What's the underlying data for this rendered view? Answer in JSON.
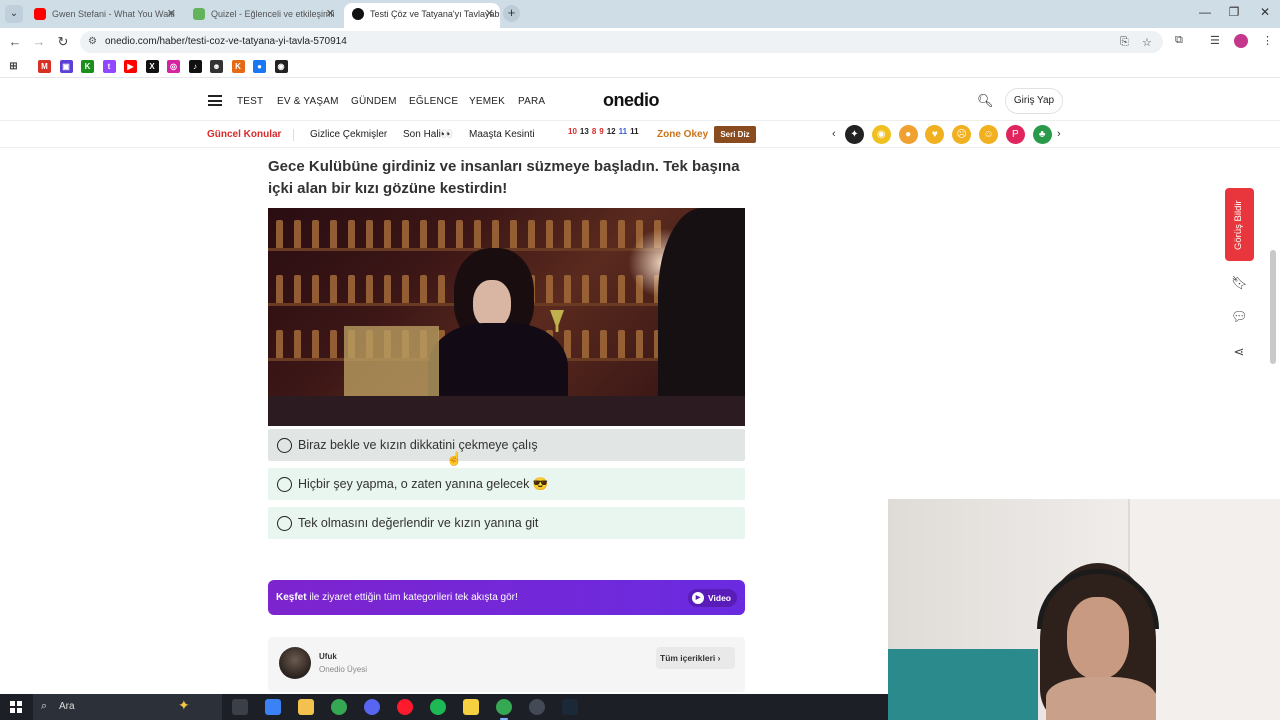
{
  "browser": {
    "tabs": [
      {
        "title": "Gwen Stefani - What You Waiti",
        "favicon_color": "#ff0000",
        "active": false
      },
      {
        "title": "Quizel - Eğlenceli ve etkileşimli",
        "favicon_color": "#62b35a",
        "active": false
      },
      {
        "title": "Testi Çöz ve Tatyana'yı Tavlayabi",
        "favicon_color": "#111111",
        "active": true
      }
    ],
    "url": "onedio.com/haber/testi-coz-ve-tatyana-yi-tavla-570914"
  },
  "bookmarks": [
    {
      "icon": "gmail-icon",
      "color": "#d93025",
      "glyph": "M"
    },
    {
      "icon": "purple-app-icon",
      "color": "#5b3fd6",
      "glyph": "▣"
    },
    {
      "icon": "kick-icon",
      "color": "#1a8f1a",
      "glyph": "K"
    },
    {
      "icon": "twitch-icon",
      "color": "#9146ff",
      "glyph": "t"
    },
    {
      "icon": "youtube-icon",
      "color": "#ff0000",
      "glyph": "▶"
    },
    {
      "icon": "x-icon",
      "color": "#111111",
      "glyph": "X"
    },
    {
      "icon": "instagram-icon",
      "color": "#d6249f",
      "glyph": "◎"
    },
    {
      "icon": "tiktok-icon",
      "color": "#111111",
      "glyph": "♪"
    },
    {
      "icon": "snapchat-icon",
      "color": "#333333",
      "glyph": "☻"
    },
    {
      "icon": "k-orange-icon",
      "color": "#e66a16",
      "glyph": "K"
    },
    {
      "icon": "circle-app-icon",
      "color": "#1877f2",
      "glyph": "●"
    },
    {
      "icon": "steam-icon",
      "color": "#222222",
      "glyph": "◉"
    }
  ],
  "site": {
    "logo": "onedio",
    "nav": [
      "TEST",
      "EV & YAŞAM",
      "GÜNDEM",
      "EĞLENCE",
      "YEMEK",
      "PARA"
    ],
    "login": "Giriş Yap",
    "subnav": {
      "current_topics": "Güncel Konular",
      "links": [
        "Gizlice Çekmişler",
        "Son Hali👀",
        "Maaşta Kesinti"
      ],
      "numbers": [
        {
          "n": "10",
          "color": "#d92b2b"
        },
        {
          "n": "13",
          "color": "#222222"
        },
        {
          "n": "8",
          "color": "#d92b2b"
        },
        {
          "n": "9",
          "color": "#d92b2b"
        },
        {
          "n": "12",
          "color": "#222222"
        },
        {
          "n": "11",
          "color": "#3a62d9"
        },
        {
          "n": "11",
          "color": "#222222"
        }
      ],
      "zone": "Zone Okey",
      "seri_diz": "Seri Diz",
      "emojis": [
        {
          "glyph": "✦",
          "color": "#222222"
        },
        {
          "glyph": "◉",
          "color": "#f0c020"
        },
        {
          "glyph": "●",
          "color": "#f0a030"
        },
        {
          "glyph": "♥",
          "color": "#f0b020"
        },
        {
          "glyph": "☹",
          "color": "#f0b020"
        },
        {
          "glyph": "☺",
          "color": "#f0b020"
        },
        {
          "glyph": "P",
          "color": "#e0245e"
        },
        {
          "glyph": "♣",
          "color": "#2a9a4a"
        }
      ]
    }
  },
  "quiz": {
    "question": "Gece Kulübüne girdiniz ve insanları süzmeye başladın. Tek başına içki alan bir kızı gözüne kestirdin!",
    "options": [
      "Biraz bekle ve kızın dikkatini çekmeye çalış",
      "Hiçbir şey yapma, o zaten yanına gelecek 😎",
      "Tek olmasını değerlendir ve kızın yanına git"
    ]
  },
  "discover": {
    "bold": "Keşfet",
    "text": " ile ziyaret ettiğin tüm kategorileri tek akışta gör!",
    "video": "Video"
  },
  "author": {
    "name": "Ufuk",
    "role": "Onedio Üyesi",
    "all_button": "Tüm içerikleri"
  },
  "sidebar": {
    "feedback": "Görüş Bildir"
  },
  "taskbar": {
    "search_label": "Ara",
    "apps": [
      "taskview-icon",
      "copilot-icon",
      "explorer-icon",
      "chrome-icon",
      "discord-icon",
      "opera-icon",
      "spotify-icon",
      "sticky-notes-icon",
      "chrome-active-icon",
      "obs-icon",
      "steam-icon"
    ]
  }
}
